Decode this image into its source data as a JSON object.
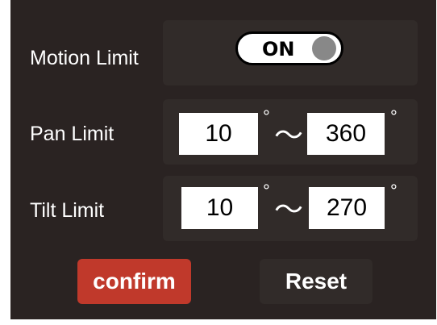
{
  "motion_limit": {
    "label": "Motion Limit",
    "toggle_state": "ON"
  },
  "pan_limit": {
    "label": "Pan Limit",
    "min": "10",
    "max": "360",
    "degree_symbol": "°",
    "separator": "～"
  },
  "tilt_limit": {
    "label": "Tilt Limit",
    "min": "10",
    "max": "270",
    "degree_symbol": "°",
    "separator": "～"
  },
  "buttons": {
    "confirm_label": "confirm",
    "reset_label": "Reset"
  },
  "colors": {
    "panel_bg": "#2a2322",
    "card_bg": "#312b29",
    "confirm_bg": "#c0392b",
    "reset_bg": "#312b29",
    "knob": "#888888"
  }
}
